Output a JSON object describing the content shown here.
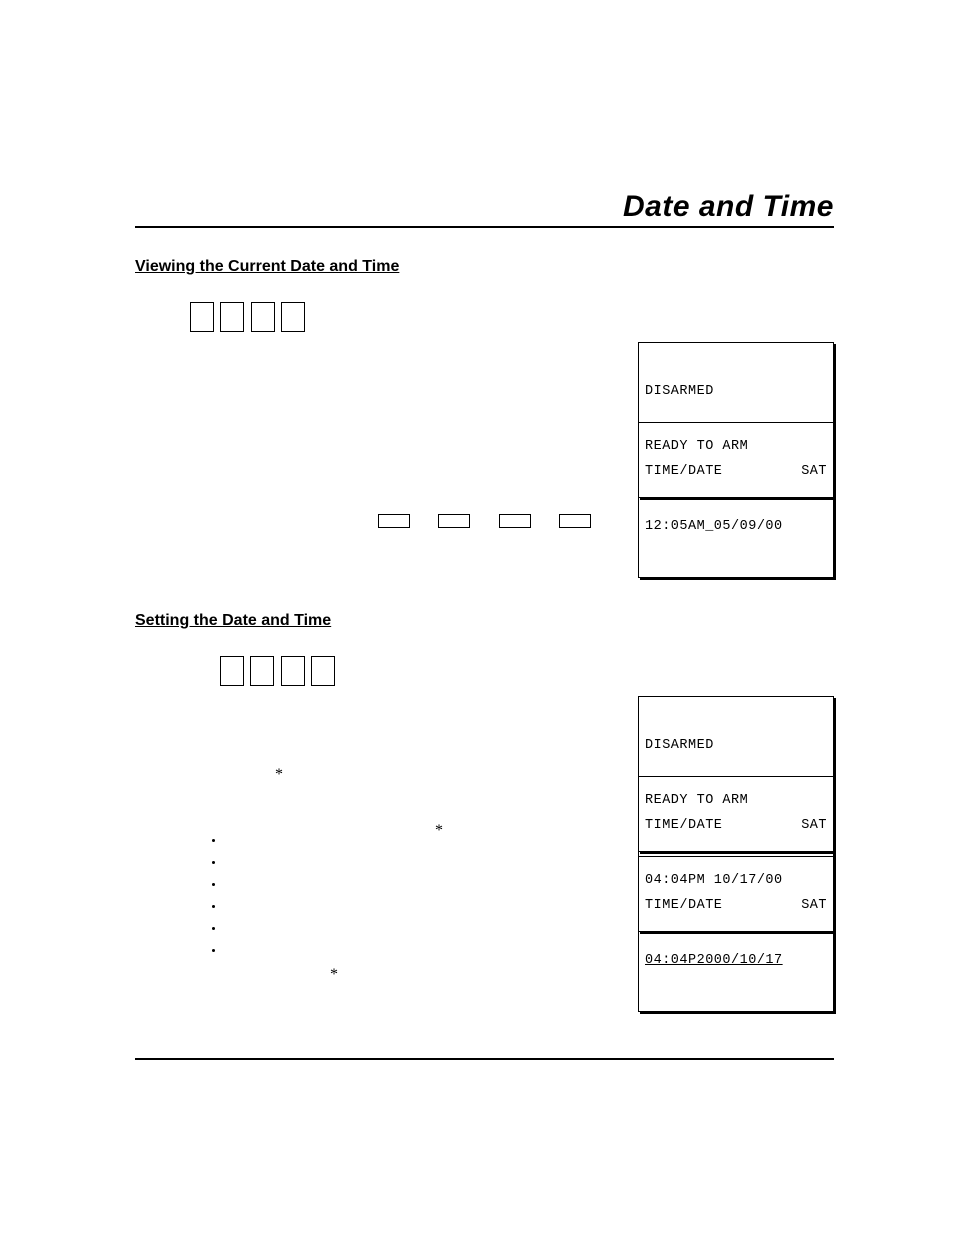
{
  "page_title": "Date and Time",
  "section1": {
    "heading": "Viewing the Current Date and Time"
  },
  "section2": {
    "heading": "Setting the Date and Time"
  },
  "lcd": {
    "disarmed_line1": "DISARMED",
    "disarmed_line2": "READY TO ARM",
    "view_td_label": "TIME/DATE",
    "view_td_day": "SAT",
    "view_td_value": "12:05AM_05/09/00",
    "set1_td_label": "TIME/DATE",
    "set1_td_day": "SAT",
    "set1_td_value": "04:04PM 10/17/00",
    "set2_td_label": "TIME/DATE",
    "set2_td_day": "SAT",
    "set2_td_value": "04:04P2000/10/17"
  }
}
